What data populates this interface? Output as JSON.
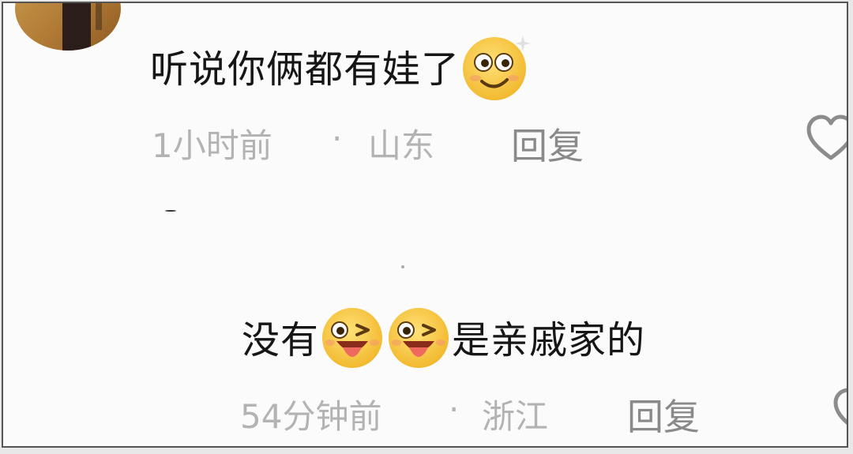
{
  "comment1": {
    "text": "听说你俩都有娃了",
    "emoji": "dizzy-smile-emoji",
    "time": "1小时前",
    "separator": "·",
    "location": "山东",
    "reply_label": "回复"
  },
  "comment2": {
    "text_before": "没有",
    "emoji": "wink-tongue-emoji",
    "text_after": "是亲戚家的",
    "time": "54分钟前",
    "separator": "·",
    "location": "浙江",
    "reply_label": "回复"
  },
  "colors": {
    "text": "#161616",
    "meta": "#b3b3b3",
    "reply": "#8a8a8a",
    "emoji_yellow": "#f7c940",
    "tongue": "#ef6a5e"
  }
}
